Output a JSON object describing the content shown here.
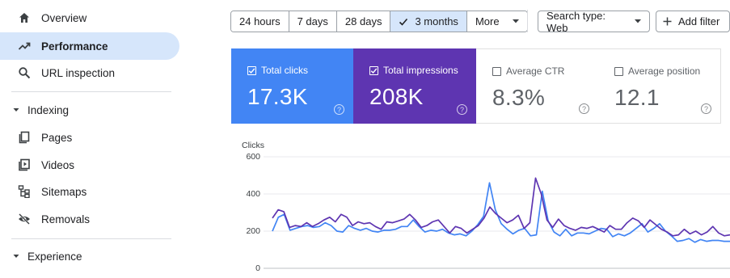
{
  "sidebar": {
    "items": [
      {
        "label": "Overview",
        "icon": "home-icon"
      },
      {
        "label": "Performance",
        "icon": "trending-up-icon",
        "active": true
      },
      {
        "label": "URL inspection",
        "icon": "search-icon"
      }
    ],
    "sections": [
      {
        "label": "Indexing",
        "items": [
          {
            "label": "Pages",
            "icon": "pages-icon"
          },
          {
            "label": "Videos",
            "icon": "video-icon"
          },
          {
            "label": "Sitemaps",
            "icon": "sitemap-icon"
          },
          {
            "label": "Removals",
            "icon": "eye-off-icon"
          }
        ]
      },
      {
        "label": "Experience",
        "items": []
      }
    ]
  },
  "toolbar": {
    "ranges": [
      "24 hours",
      "7 days",
      "28 days",
      "3 months",
      "More"
    ],
    "selected_range": "3 months",
    "search_type": "Search type: Web",
    "add_filter": "Add filter"
  },
  "metrics": [
    {
      "label": "Total clicks",
      "value": "17.3K",
      "checked": true,
      "color": "#4285f4"
    },
    {
      "label": "Total impressions",
      "value": "208K",
      "checked": true,
      "color": "#5e35b1"
    },
    {
      "label": "Average CTR",
      "value": "8.3%",
      "checked": false,
      "color": "#ffffff"
    },
    {
      "label": "Average position",
      "value": "12.1",
      "checked": false,
      "color": "#ffffff"
    }
  ],
  "chart_data": {
    "type": "line",
    "ylabel": "Clicks",
    "yticks": [
      0,
      200,
      400,
      600
    ],
    "ylim": [
      0,
      600
    ],
    "grid": true,
    "series": [
      {
        "name": "Total clicks",
        "color": "#4285f4",
        "values": [
          200,
          275,
          290,
          205,
          215,
          225,
          230,
          220,
          225,
          245,
          230,
          200,
          195,
          230,
          215,
          205,
          215,
          200,
          195,
          205,
          205,
          210,
          225,
          225,
          260,
          225,
          195,
          205,
          200,
          210,
          190,
          180,
          185,
          175,
          200,
          235,
          280,
          460,
          315,
          240,
          210,
          185,
          205,
          215,
          175,
          180,
          415,
          255,
          195,
          175,
          210,
          175,
          190,
          190,
          185,
          200,
          215,
          210,
          170,
          185,
          175,
          190,
          215,
          240,
          195,
          215,
          240,
          200,
          175,
          145,
          150,
          160,
          140,
          155,
          145,
          150,
          150,
          145,
          145
        ]
      },
      {
        "name": "Total impressions",
        "color": "#5e35b1",
        "values": [
          270,
          315,
          305,
          220,
          230,
          225,
          245,
          225,
          240,
          260,
          275,
          250,
          290,
          275,
          230,
          250,
          240,
          245,
          225,
          210,
          250,
          245,
          255,
          265,
          290,
          260,
          220,
          230,
          250,
          260,
          225,
          190,
          225,
          215,
          190,
          210,
          230,
          270,
          330,
          295,
          270,
          245,
          260,
          285,
          215,
          245,
          485,
          400,
          260,
          220,
          265,
          230,
          215,
          205,
          220,
          215,
          225,
          210,
          195,
          230,
          210,
          210,
          245,
          270,
          255,
          220,
          260,
          235,
          210,
          195,
          175,
          180,
          210,
          185,
          200,
          180,
          195,
          225,
          190,
          175,
          180
        ]
      }
    ]
  }
}
